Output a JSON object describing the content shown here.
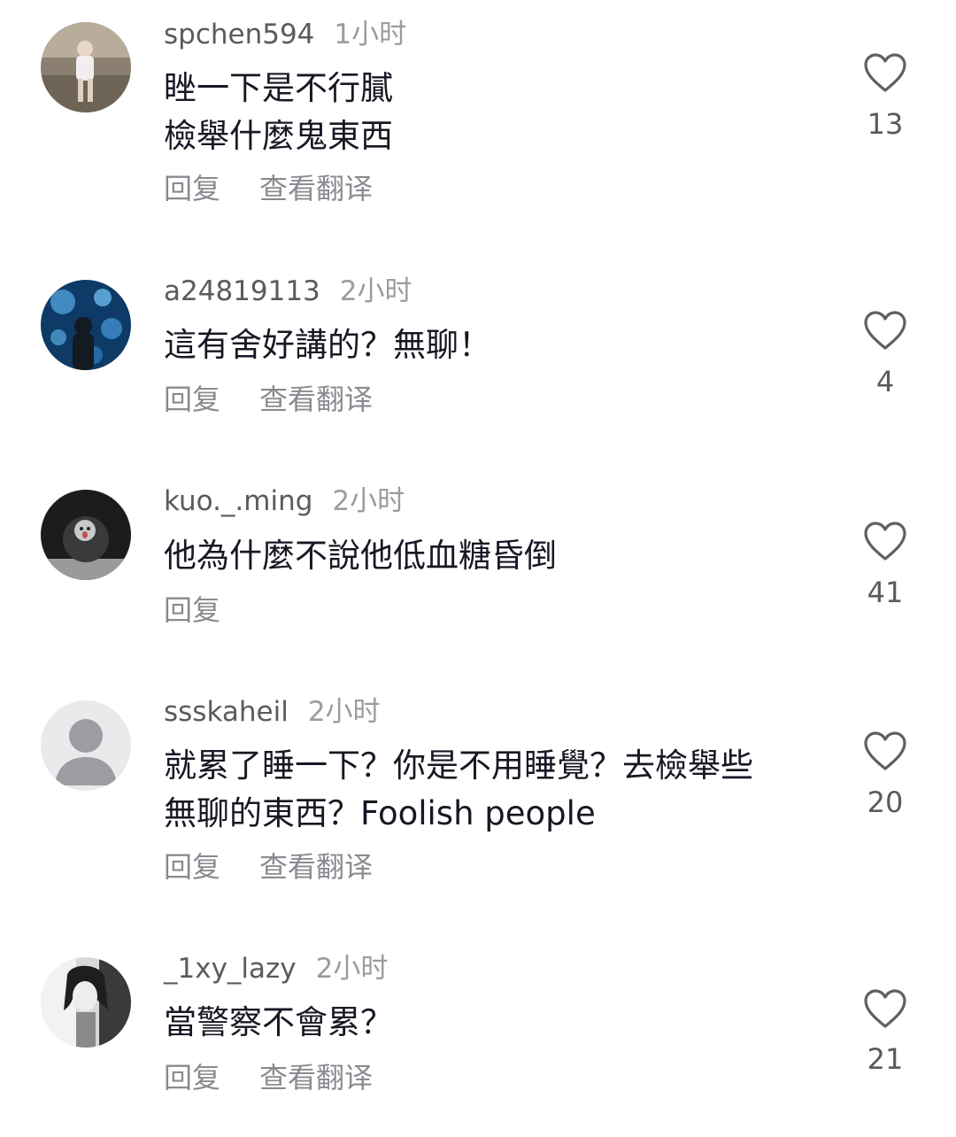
{
  "comments": [
    {
      "username": "spchen594",
      "time": "1小时",
      "text": "睉一下是不行膩\n檢舉什麼鬼東西",
      "reply": "回复",
      "translate": "查看翻译",
      "likes": "13"
    },
    {
      "username": "a24819113",
      "time": "2小时",
      "text": "這有舍好講的？無聊！",
      "reply": "回复",
      "translate": "查看翻译",
      "likes": "4"
    },
    {
      "username": "kuo._.ming",
      "time": "2小时",
      "text": "他為什麼不說他低血糖昏倒",
      "reply": "回复",
      "likes": "41"
    },
    {
      "username": "ssskaheil",
      "time": "2小时",
      "text": "就累了睡一下？你是不用睡覺？去檢舉些\n無聊的東西？Foolish people",
      "reply": "回复",
      "translate": "查看翻译",
      "likes": "20"
    },
    {
      "username": "_1xy_lazy",
      "time": "2小时",
      "text": "當警察不會累？",
      "reply": "回复",
      "translate": "查看翻译",
      "likes": "21"
    }
  ]
}
